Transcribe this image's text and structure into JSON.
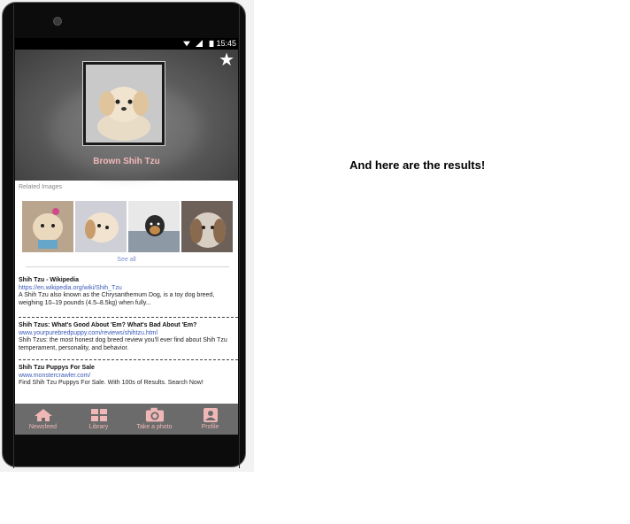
{
  "statusbar": {
    "time": "15:45",
    "icons": [
      "wifi-icon",
      "signal-icon",
      "battery-icon"
    ]
  },
  "hero": {
    "title": "Brown Shih Tzu",
    "favorite_icon": "star-icon"
  },
  "related": {
    "label": "Related Images",
    "images": [
      "dog-thumbnail-1",
      "dog-thumbnail-2",
      "dog-thumbnail-3",
      "dog-thumbnail-4"
    ],
    "see_all": "See all"
  },
  "results": [
    {
      "title": "Shih Tzu - Wikipedia",
      "url": "https://en.wikipedia.org/wiki/Shih_Tzu",
      "snippet": "A Shih Tzu also known as the Chrysanthemum Dog, is a toy dog breed, weighing 10–19 pounds (4.5–8.5kg) when fully..."
    },
    {
      "title": "Shih Tzus: What's Good About 'Em? What's Bad About 'Em?",
      "url": "www.yourpurebredpuppy.com/reviews/shihtzu.html",
      "snippet": "Shih Tzus: the most honest dog breed review you'll ever find about Shih Tzu temperament, personality, and behavior."
    },
    {
      "title": "Shih Tzu Puppys For Sale",
      "url": "www.monstercrawler.com/",
      "snippet": "Find Shih Tzu Puppys For Sale. With 100s of Results. Search Now!"
    }
  ],
  "nav": [
    {
      "label": "Newsfeed",
      "icon": "home-icon"
    },
    {
      "label": "Library",
      "icon": "grid-icon"
    },
    {
      "label": "Take a photo",
      "icon": "camera-icon"
    },
    {
      "label": "Profile",
      "icon": "profile-icon"
    }
  ],
  "caption": "And here are the results!",
  "colors": {
    "accent_pink": "#f3b8b8",
    "navbar": "#6b6b6b",
    "link": "#3b5bb8"
  }
}
